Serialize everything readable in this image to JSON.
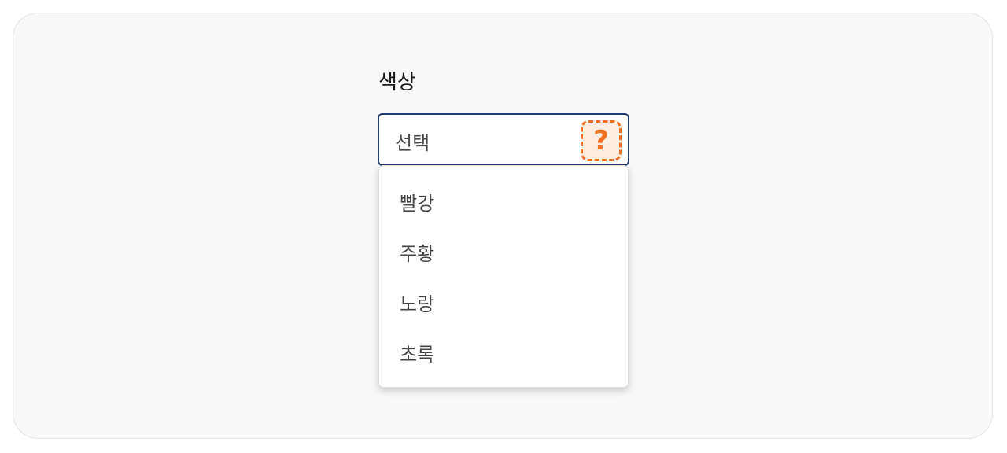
{
  "form": {
    "label": "색상",
    "select": {
      "value": "선택",
      "help_icon": "question-mark-icon",
      "help_glyph": "?"
    },
    "options": [
      {
        "label": "빨강"
      },
      {
        "label": "주황"
      },
      {
        "label": "노랑"
      },
      {
        "label": "초록"
      }
    ]
  },
  "colors": {
    "focus_border": "#1f3f7a",
    "help_accent": "#f07124"
  }
}
